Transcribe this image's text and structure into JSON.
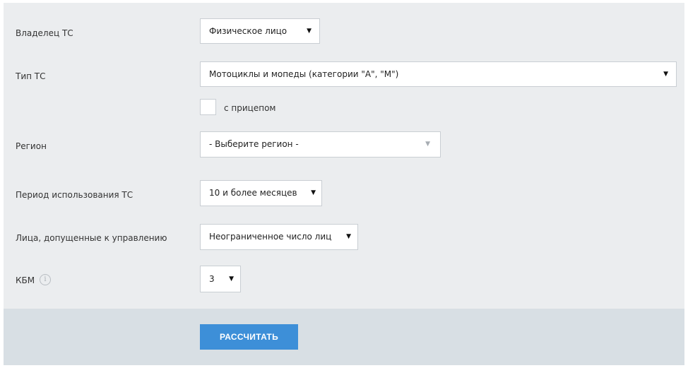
{
  "form": {
    "owner": {
      "label": "Владелец ТС",
      "value": "Физическое лицо"
    },
    "vehicle_type": {
      "label": "Тип ТС",
      "value": "Мотоциклы и мопеды (категории \"А\", \"М\")"
    },
    "trailer": {
      "label": "с прицепом",
      "checked": false
    },
    "region": {
      "label": "Регион",
      "value": "- Выберите регион -"
    },
    "usage_period": {
      "label": "Период использования ТС",
      "value": "10 и более месяцев"
    },
    "drivers": {
      "label": "Лица, допущенные к управлению",
      "value": "Неограниченное число лиц"
    },
    "kbm": {
      "label": "КБМ",
      "value": "3",
      "info_icon": "info-icon"
    }
  },
  "actions": {
    "calculate_label": "РАССЧИТАТЬ"
  },
  "colors": {
    "panel_bg": "#ebedef",
    "footer_bg": "#d8dfe4",
    "button_bg": "#3d8fd8",
    "button_text": "#ffffff"
  }
}
